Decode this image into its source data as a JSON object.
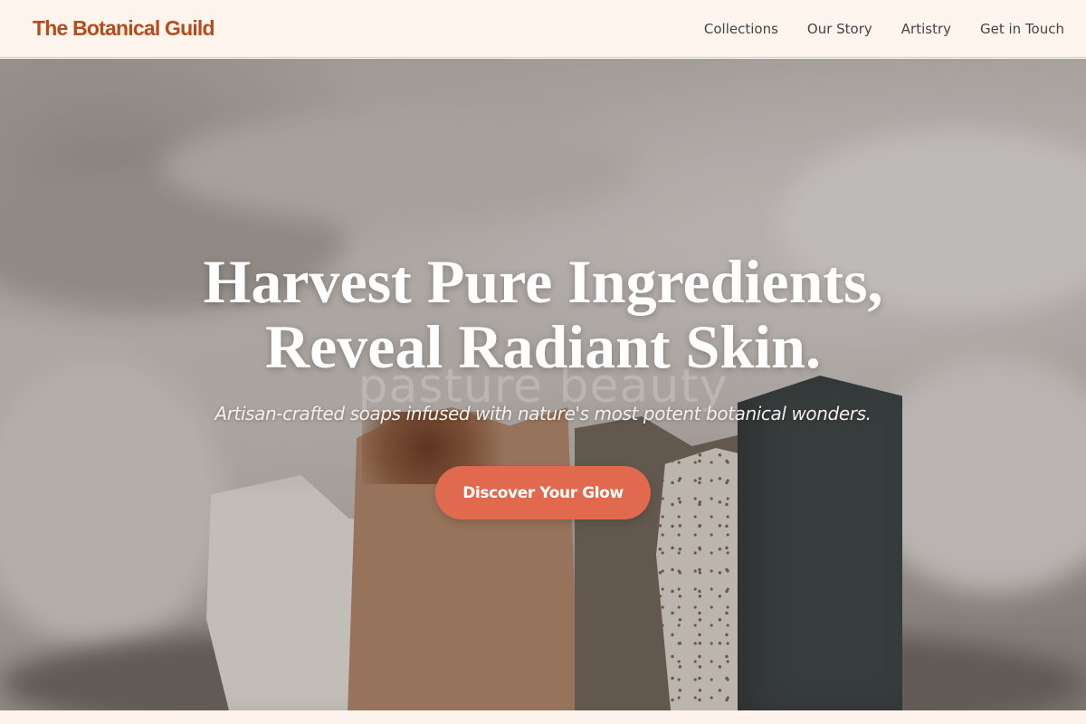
{
  "brand": {
    "name": "The Botanical Guild"
  },
  "nav": {
    "items": [
      {
        "label": "Collections"
      },
      {
        "label": "Our Story"
      },
      {
        "label": "Artistry"
      },
      {
        "label": "Get in Touch"
      }
    ]
  },
  "hero": {
    "headline_line1": "Harvest Pure Ingredients,",
    "headline_line2": "Reveal Radiant Skin.",
    "watermark": "pasture beauty",
    "subtitle": "Artisan-crafted soaps infused with nature's most potent botanical wonders.",
    "cta_label": "Discover Your Glow",
    "image_subject": "handmade soap bars on linen"
  },
  "colors": {
    "brand": "#b64c1c",
    "cta": "#e0694e",
    "header_bg": "#fdf4ee",
    "nav_text": "#444444"
  }
}
